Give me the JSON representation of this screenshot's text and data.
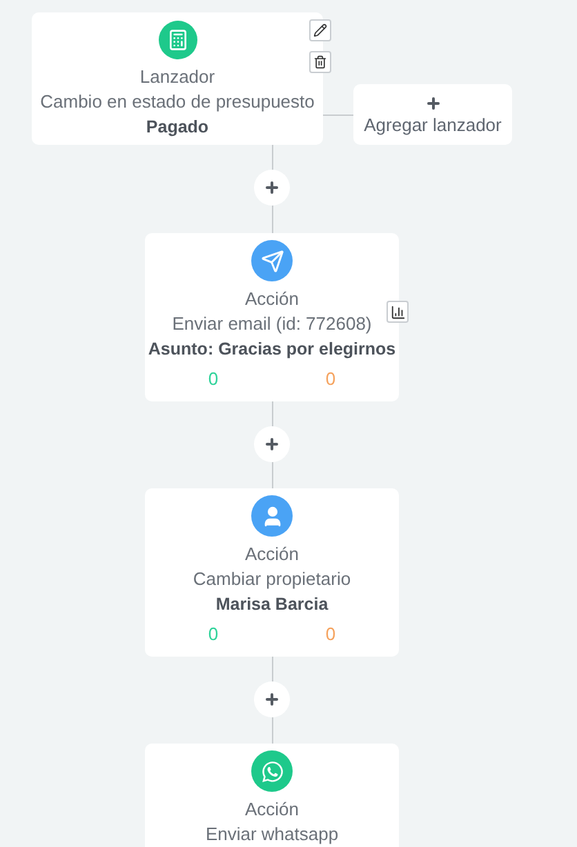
{
  "trigger": {
    "kind": "calculator",
    "color": "#1ec98b",
    "title": "Lanzador",
    "description": "Cambio en estado de presupuesto",
    "value": "Pagado"
  },
  "add_trigger": {
    "label": "Agregar lanzador"
  },
  "actions": [
    {
      "kind": "send",
      "color": "#4aa3f5",
      "title": "Acción",
      "description": "Enviar email (id: 772608)",
      "detail": "Asunto: Gracias por elegirnos",
      "count_success": "0",
      "count_failed": "0",
      "has_stats": true
    },
    {
      "kind": "user",
      "color": "#4aa3f5",
      "title": "Acción",
      "description": "Cambiar propietario",
      "detail": "Marisa Barcia",
      "count_success": "0",
      "count_failed": "0",
      "has_stats": false
    },
    {
      "kind": "whatsapp",
      "color": "#1ec98b",
      "title": "Acción",
      "description": "Enviar whatsapp",
      "has_stats": false
    }
  ]
}
